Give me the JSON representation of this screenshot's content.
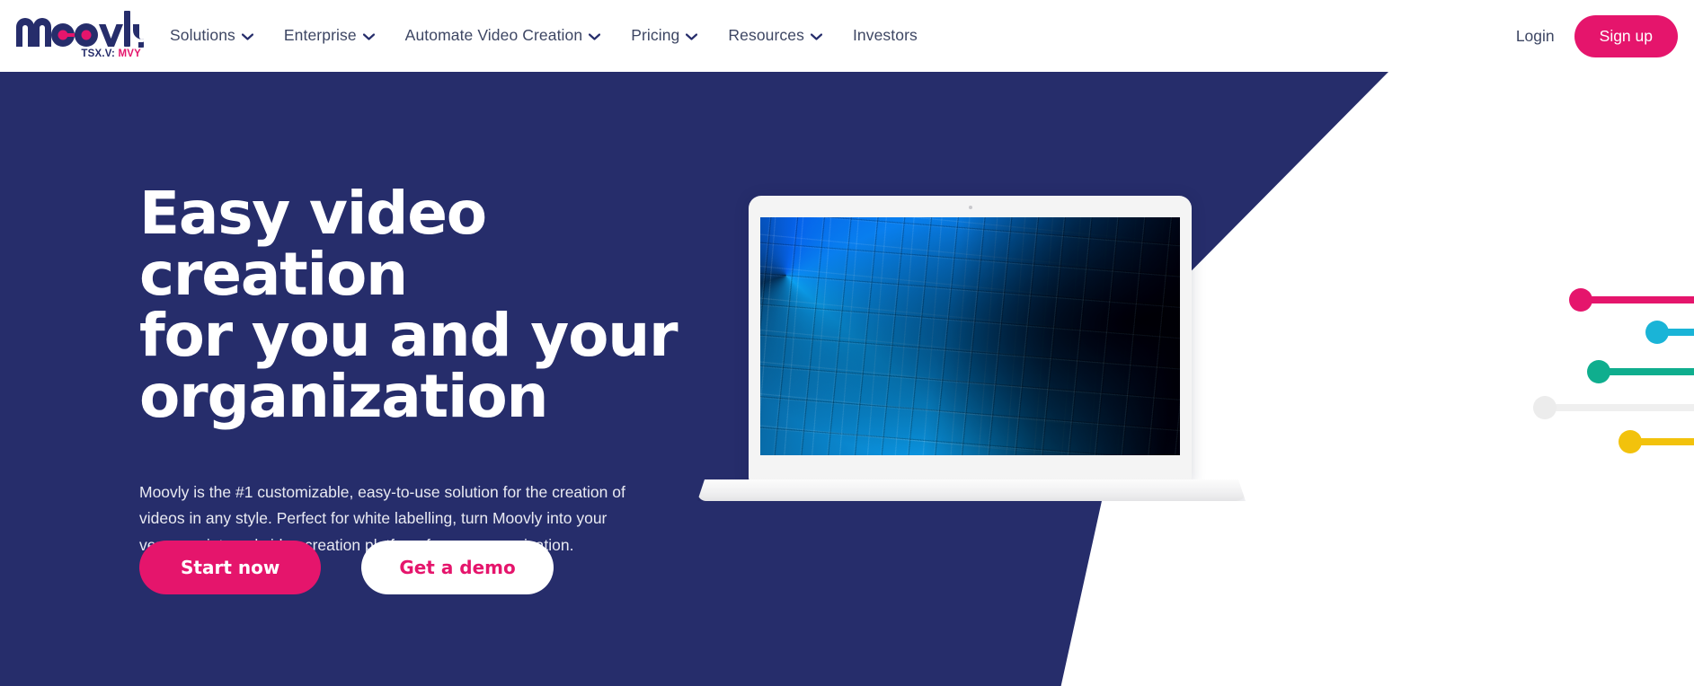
{
  "brand": {
    "name": "moovly",
    "ticker_prefix": "TSX.V:",
    "ticker_symbol": "MVY",
    "colors": {
      "navy": "#262d6b",
      "pink": "#e5156c",
      "cyan": "#1ab4d7",
      "teal": "#0fae8e",
      "yellow": "#f2c20c",
      "grey": "#ededed"
    }
  },
  "nav": {
    "items": [
      {
        "label": "Solutions",
        "has_dropdown": true,
        "icon": "chevron-down-icon"
      },
      {
        "label": "Enterprise",
        "has_dropdown": true,
        "icon": "chevron-down-icon"
      },
      {
        "label": "Automate Video Creation",
        "has_dropdown": true,
        "icon": "chevron-down-icon"
      },
      {
        "label": "Pricing",
        "has_dropdown": true,
        "icon": "chevron-down-icon"
      },
      {
        "label": "Resources",
        "has_dropdown": true,
        "icon": "chevron-down-icon"
      },
      {
        "label": "Investors",
        "has_dropdown": false,
        "icon": ""
      }
    ],
    "login_label": "Login",
    "signup_label": "Sign up"
  },
  "hero": {
    "title": "Easy video creation\nfor you and your\norganization",
    "paragraph": "Moovly is the #1 customizable, easy-to-use solution for the creation of videos in any style. Perfect for white labelling, turn Moovly into your very own internal video creation platform for your organisation.",
    "primary_cta": "Start now",
    "secondary_cta": "Get a demo",
    "laptop_screen_alt": "wall of colorful video thumbnails receding into darkness"
  },
  "sliders": [
    {
      "name": "slider-pink",
      "color": "#e5156c",
      "knob_color": "#e5156c"
    },
    {
      "name": "slider-cyan",
      "color": "#1ab4d7",
      "knob_color": "#1ab4d7"
    },
    {
      "name": "slider-teal",
      "color": "#0fae8e",
      "knob_color": "#0fae8e"
    },
    {
      "name": "slider-grey",
      "color": "#efefef",
      "knob_color": "#ececec"
    },
    {
      "name": "slider-yellow",
      "color": "#f2c20c",
      "knob_color": "#f2c20c"
    }
  ]
}
